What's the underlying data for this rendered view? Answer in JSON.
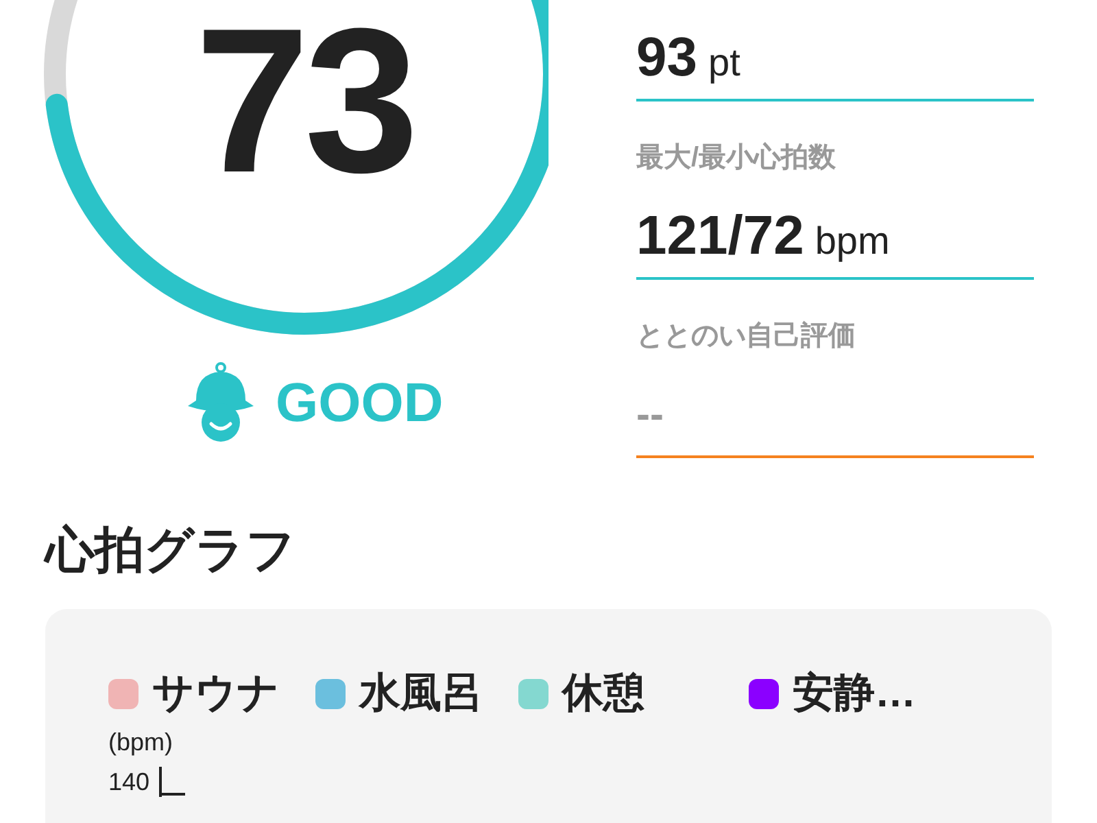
{
  "score": {
    "value": "73",
    "rating": "GOOD"
  },
  "stats": [
    {
      "value": "93",
      "unit": "pt",
      "color": "#2bc3c8"
    },
    {
      "label": "最大/最小心拍数",
      "value": "121/72",
      "unit": "bpm",
      "color": "#2bc3c8"
    },
    {
      "label": "ととのい自己評価",
      "value": "--",
      "color": "#f5821f"
    }
  ],
  "heart_rate_graph": {
    "title": "心拍グラフ",
    "legend": [
      {
        "label": "サウナ",
        "color": "#f0b4b4"
      },
      {
        "label": "水風呂",
        "color": "#6bbfde"
      },
      {
        "label": "休憩",
        "color": "#84d8d0"
      },
      {
        "label": "安静…",
        "color": "#8b00ff"
      }
    ],
    "y_unit": "(bpm)",
    "y_tick": "140"
  }
}
